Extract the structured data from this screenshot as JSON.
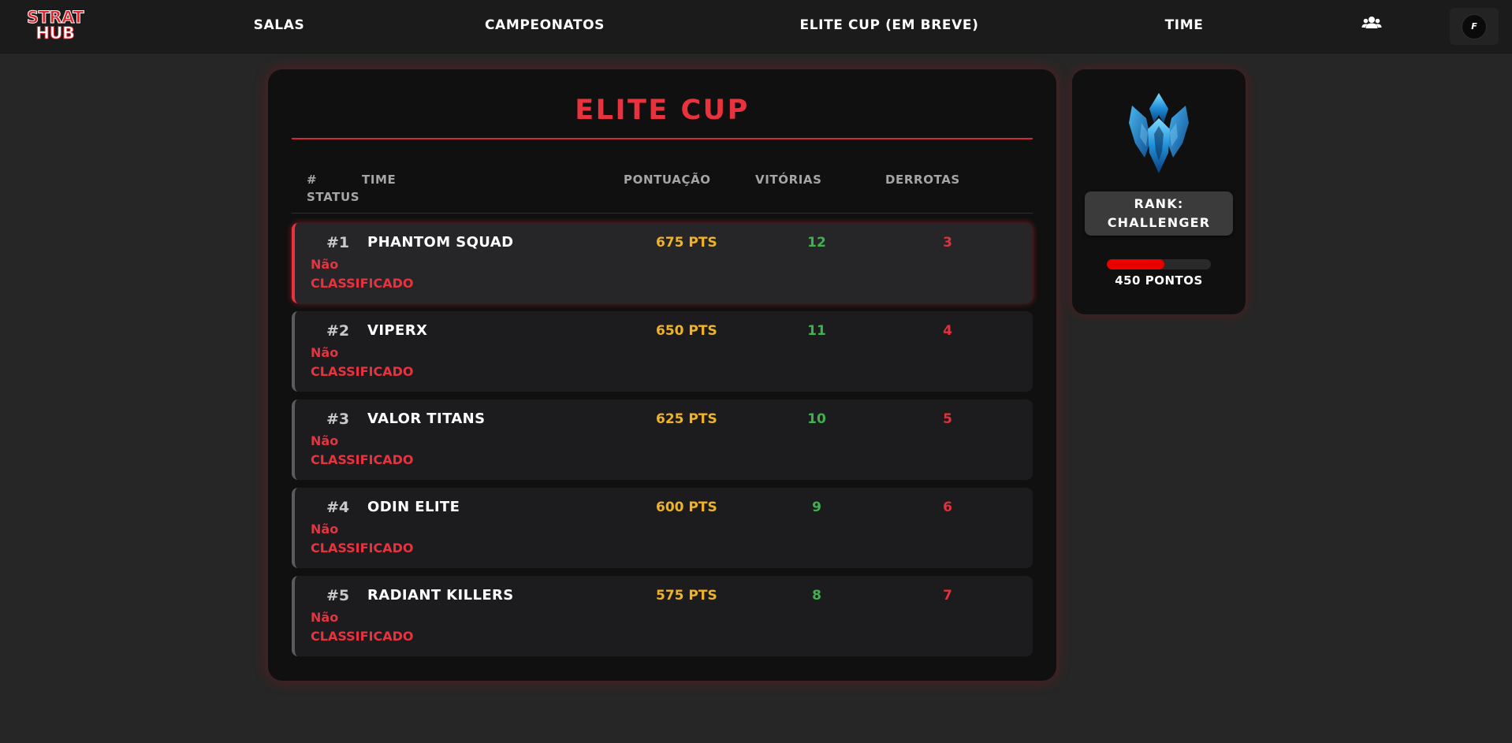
{
  "nav": {
    "logo_line1": "STRAT",
    "logo_line2": "HUB",
    "links": [
      "SALAS",
      "CAMPEONATOS",
      "ELITE CUP (EM BREVE)",
      "TIME"
    ],
    "users_icon": "users-icon",
    "profile_initial": "F"
  },
  "leaderboard": {
    "title": "ELITE CUP",
    "headers": {
      "rank": "#",
      "team": "TIME",
      "points": "PONTUAÇÃO",
      "wins": "VITÓRIAS",
      "losses": "DERROTAS",
      "status": "STATUS"
    },
    "rows": [
      {
        "rank": "#1",
        "team": "PHANTOM SQUAD",
        "points": "675 PTS",
        "wins": "12",
        "losses": "3",
        "status_line1": "Não",
        "status_line2": "CLASSIFICADO"
      },
      {
        "rank": "#2",
        "team": "VIPERX",
        "points": "650 PTS",
        "wins": "11",
        "losses": "4",
        "status_line1": "Não",
        "status_line2": "CLASSIFICADO"
      },
      {
        "rank": "#3",
        "team": "VALOR TITANS",
        "points": "625 PTS",
        "wins": "10",
        "losses": "5",
        "status_line1": "Não",
        "status_line2": "CLASSIFICADO"
      },
      {
        "rank": "#4",
        "team": "ODIN ELITE",
        "points": "600 PTS",
        "wins": "9",
        "losses": "6",
        "status_line1": "Não",
        "status_line2": "CLASSIFICADO"
      },
      {
        "rank": "#5",
        "team": "RADIANT KILLERS",
        "points": "575 PTS",
        "wins": "8",
        "losses": "7",
        "status_line1": "Não",
        "status_line2": "CLASSIFICADO"
      }
    ]
  },
  "profile_card": {
    "emblem_icon": "challenger-emblem-icon",
    "rank_line1": "RANK:",
    "rank_line2": "CHALLENGER",
    "progress_fraction": 0.55,
    "points_label": "450 PONTOS"
  },
  "colors": {
    "background": "#262626",
    "accent_red": "#e8333f",
    "points_yellow": "#f0b323",
    "wins_green": "#3fb24f",
    "losses_red": "#e0323c",
    "progress_red": "#e80000"
  }
}
